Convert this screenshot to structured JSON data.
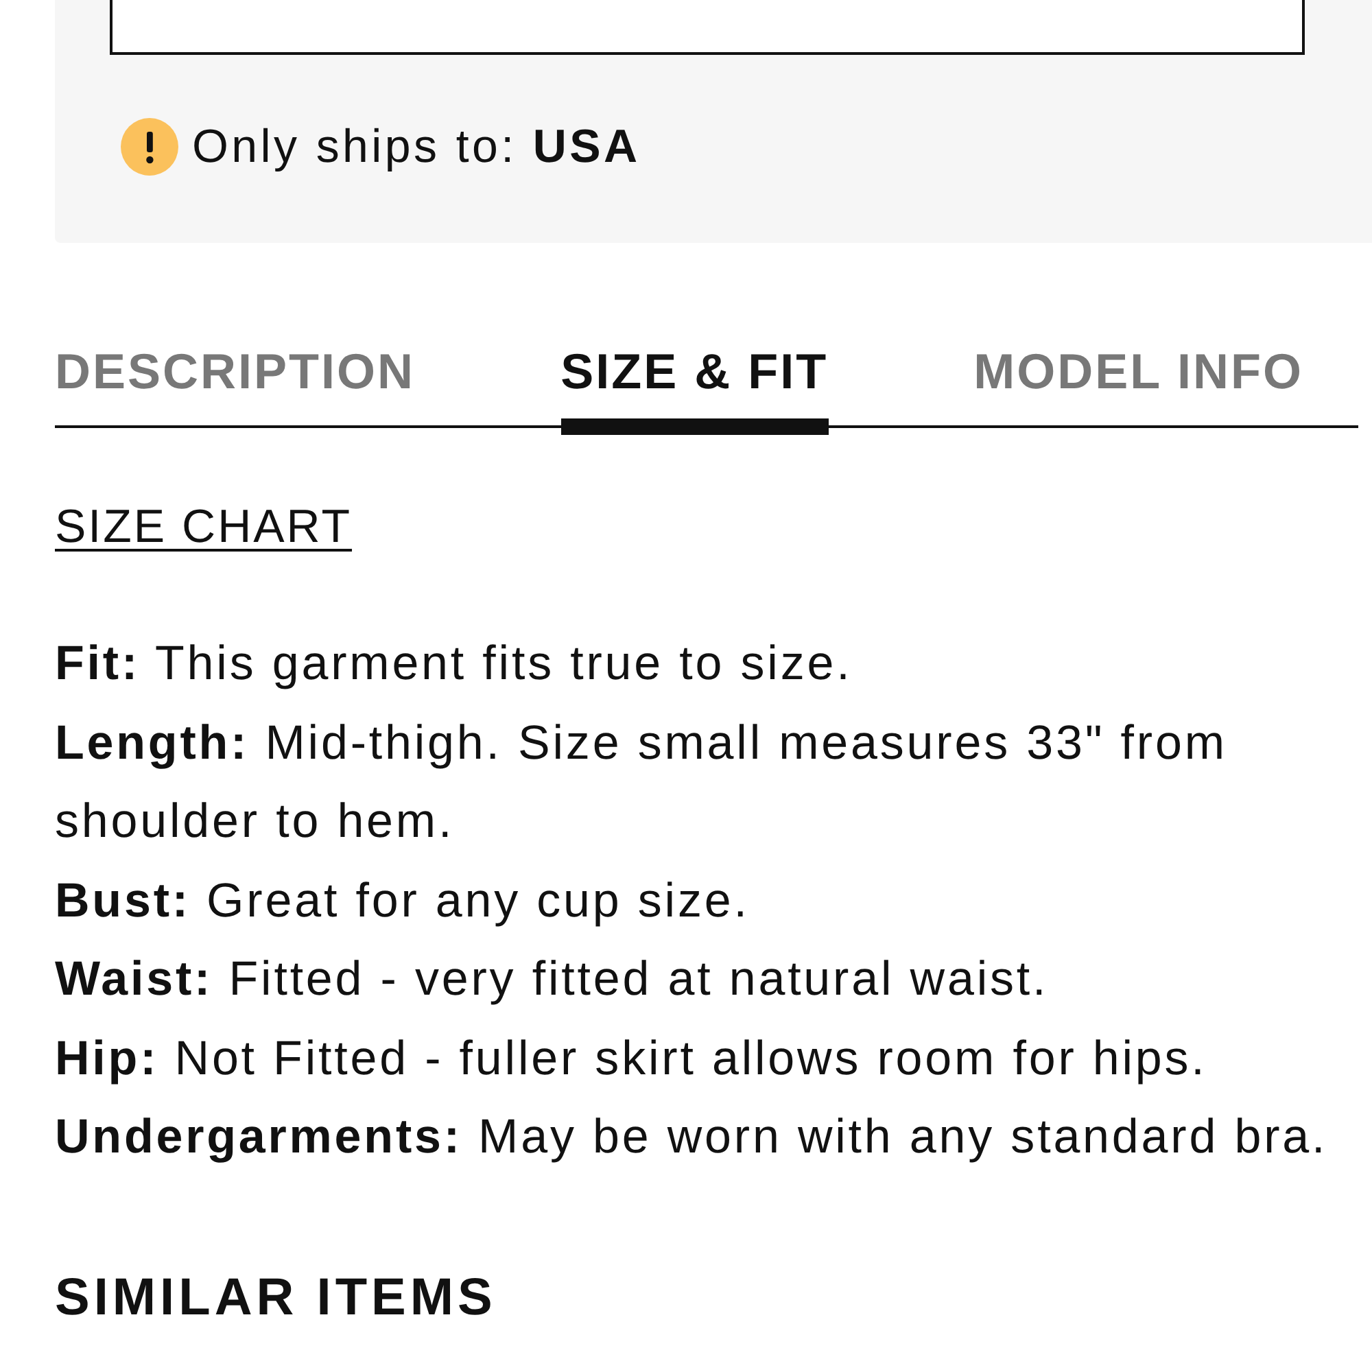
{
  "shipping_notice": {
    "text": "Only ships to: **USA**"
  },
  "tabs": [
    {
      "label": "DESCRIPTION",
      "selected": false
    },
    {
      "label": "SIZE & FIT",
      "selected": true
    },
    {
      "label": "MODEL INFO",
      "selected": false
    }
  ],
  "size_chart_link": "SIZE CHART",
  "fit_details": [
    "**Fit:** This garment fits true to size.",
    "**Length:** Mid-thigh. Size small measures 33\" from shoulder to hem.",
    "**Bust:** Great for any cup size.",
    "**Waist:** Fitted - very fitted at natural waist.",
    "**Hip:** Not Fitted - fuller skirt allows room for hips.",
    "**Undergarments:** May be worn with any standard bra."
  ],
  "similar_items_heading": "SIMILAR ITEMS"
}
